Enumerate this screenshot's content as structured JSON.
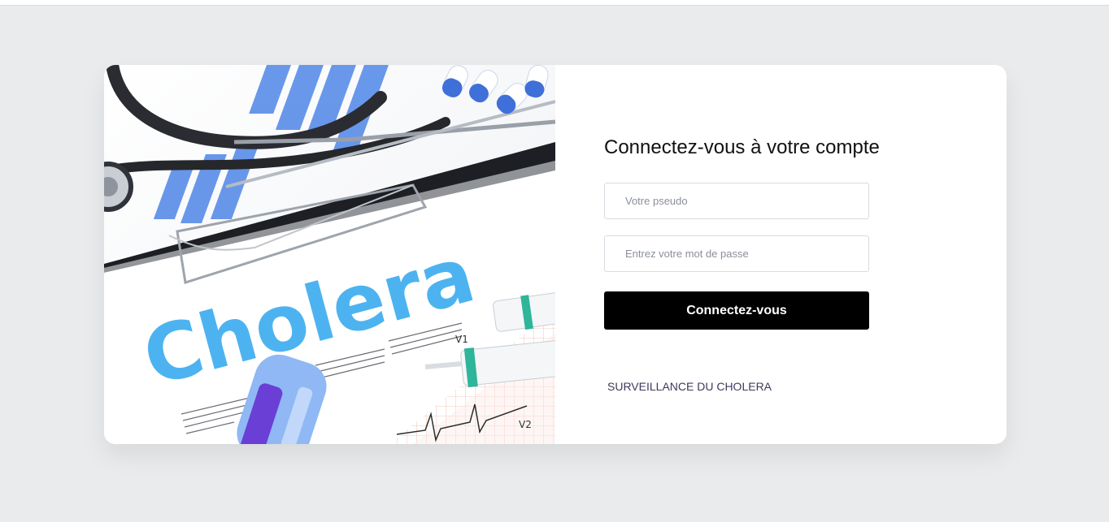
{
  "hero": {
    "image_label": "Cholera",
    "ecg_labels": [
      "V1",
      "V2"
    ]
  },
  "login": {
    "title": "Connectez-vous à votre compte",
    "username_placeholder": "Votre pseudo",
    "password_placeholder": "Entrez votre mot de passe",
    "submit_label": "Connectez-vous",
    "footer_link": "SURVEILLANCE DU CHOLERA"
  },
  "colors": {
    "page_background": "#eaebed",
    "card_background": "#ffffff",
    "button_background": "#000000",
    "button_text": "#ffffff",
    "link_text": "#3d3a5c",
    "accent_blue": "#4db3f0"
  }
}
